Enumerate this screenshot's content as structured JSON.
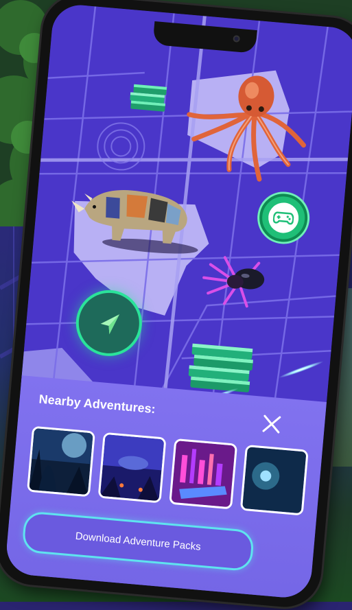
{
  "panel": {
    "title": "Nearby Adventures:",
    "close_icon": "close-icon",
    "download_label": "Download Adventure Packs"
  },
  "adventures": [
    {
      "name": "adventure-forest",
      "colors": [
        "#0d1f3a",
        "#2a5a8a",
        "#9fe0ff"
      ]
    },
    {
      "name": "adventure-underwater",
      "colors": [
        "#1a1a6a",
        "#3c3cbf",
        "#ff7a3a"
      ]
    },
    {
      "name": "adventure-neon-city",
      "colors": [
        "#6a1a8a",
        "#b43cff",
        "#ff4fd8"
      ]
    },
    {
      "name": "adventure-cave",
      "colors": [
        "#0e2a4a",
        "#2c6a8a",
        "#9fe0ff"
      ]
    }
  ],
  "map_items": {
    "creatures": [
      "octopus",
      "rhino",
      "spider"
    ],
    "collectibles": [
      "books-small",
      "books-large"
    ],
    "gamepad_icon": "gamepad-icon",
    "locate_icon": "navigation-arrow-icon"
  },
  "colors": {
    "map_background": "#4a36c9",
    "panel": "#7b68ee",
    "accent_green": "#1fbf77",
    "button_border": "#5fe3ef"
  }
}
